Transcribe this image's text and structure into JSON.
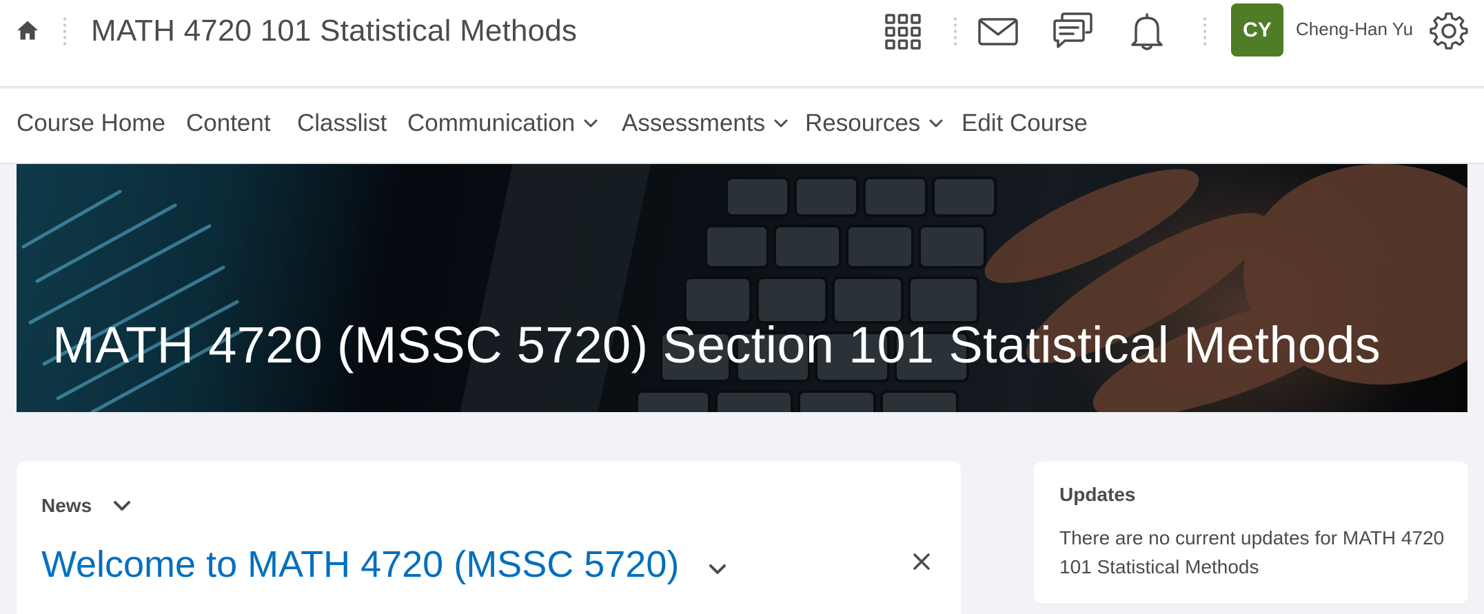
{
  "header": {
    "course_title": "MATH 4720 101 Statistical Methods",
    "user_initials": "CY",
    "user_name": "Cheng-Han Yu",
    "avatar_color": "#4f7d27",
    "icons": [
      "home-icon",
      "waffle-grid-icon",
      "mail-icon",
      "chat-icon",
      "bell-icon",
      "gear-icon"
    ]
  },
  "nav": {
    "items": [
      {
        "label": "Course Home",
        "dropdown": false
      },
      {
        "label": "Content",
        "dropdown": false
      },
      {
        "label": "Classlist",
        "dropdown": false
      },
      {
        "label": "Communication",
        "dropdown": true
      },
      {
        "label": "Assessments",
        "dropdown": true
      },
      {
        "label": "Resources",
        "dropdown": true
      },
      {
        "label": "Edit Course",
        "dropdown": false
      }
    ]
  },
  "banner": {
    "title": "MATH 4720 (MSSC 5720) Section 101 Statistical Methods"
  },
  "news": {
    "label": "News",
    "item_title": "Welcome to MATH 4720 (MSSC 5720)"
  },
  "updates": {
    "title": "Updates",
    "message": "There are no current updates for MATH 4720 101 Statistical Methods"
  },
  "colors": {
    "link_blue": "#006fbf",
    "text_gray": "#494c4e",
    "page_bg": "#f1f3f6"
  }
}
